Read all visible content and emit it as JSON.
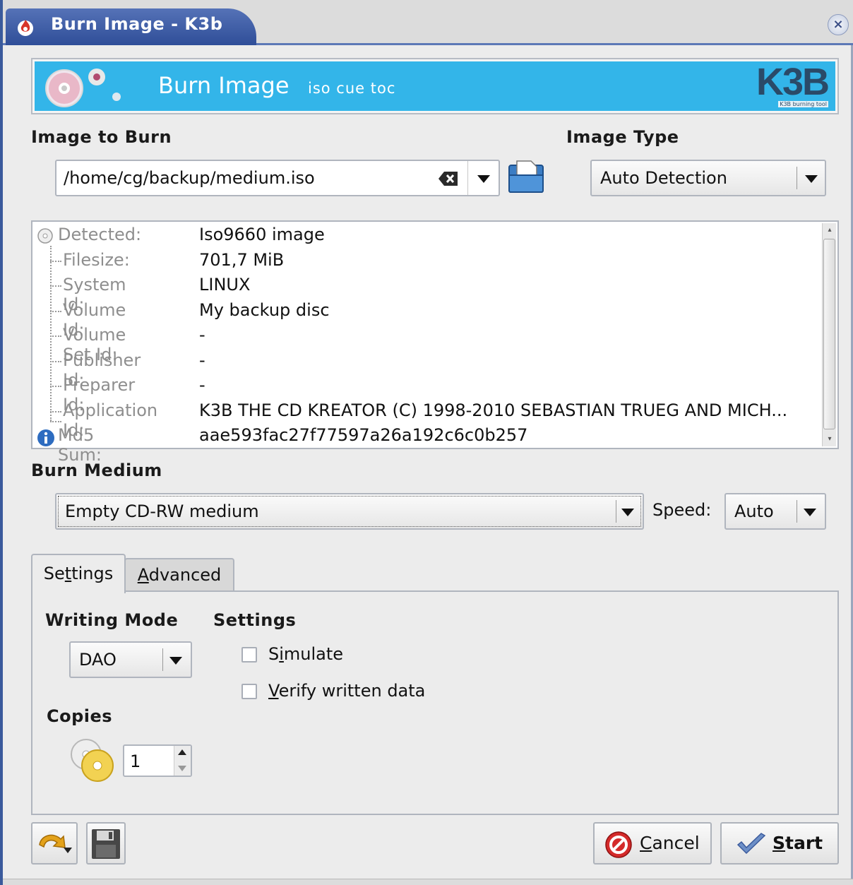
{
  "window": {
    "title": "Burn Image - K3b",
    "close_symbol": "×"
  },
  "banner": {
    "title": "Burn Image",
    "subtitle": "iso cue toc",
    "logo_text": "K3B",
    "logo_sub": "K3B burning tool",
    "bg": "#33b5e9"
  },
  "image_to_burn": {
    "label": "Image to Burn",
    "path": "/home/cg/backup/medium.iso"
  },
  "image_type": {
    "label": "Image Type",
    "value": "Auto Detection"
  },
  "info": {
    "rows": [
      {
        "key": "Detected:",
        "value": "Iso9660 image"
      },
      {
        "key": "Filesize:",
        "value": "701,7 MiB"
      },
      {
        "key": "System Id:",
        "value": "LINUX"
      },
      {
        "key": "Volume Id:",
        "value": "My backup disc"
      },
      {
        "key": "Volume Set Id:",
        "value": "-"
      },
      {
        "key": "Publisher Id:",
        "value": "-"
      },
      {
        "key": "Preparer Id:",
        "value": "-"
      },
      {
        "key": "Application Id:",
        "value": "K3B THE CD KREATOR (C) 1998-2010 SEBASTIAN TRUEG AND MICH..."
      },
      {
        "key": "Md5 Sum:",
        "value": "aae593fac27f77597a26a192c6c0b257"
      }
    ]
  },
  "burn_medium": {
    "label": "Burn Medium",
    "value": "Empty CD-RW medium",
    "speed_label": "Speed:",
    "speed_value": "Auto"
  },
  "tabs": {
    "settings": {
      "pre": "Se",
      "ul": "t",
      "post": "tings"
    },
    "advanced": {
      "pre": "",
      "ul": "A",
      "post": "dvanced"
    }
  },
  "settings_tab": {
    "writing_mode_label": "Writing Mode",
    "writing_mode_value": "DAO",
    "settings_label": "Settings",
    "simulate": {
      "pre": "S",
      "ul": "i",
      "post": "mulate"
    },
    "verify": {
      "pre": "",
      "ul": "V",
      "post": "erify written data"
    },
    "copies_label": "Copies",
    "copies_value": "1"
  },
  "buttons": {
    "cancel": {
      "pre": "",
      "ul": "C",
      "post": "ancel"
    },
    "start": {
      "pre": "",
      "ul": "S",
      "post": "tart"
    }
  }
}
